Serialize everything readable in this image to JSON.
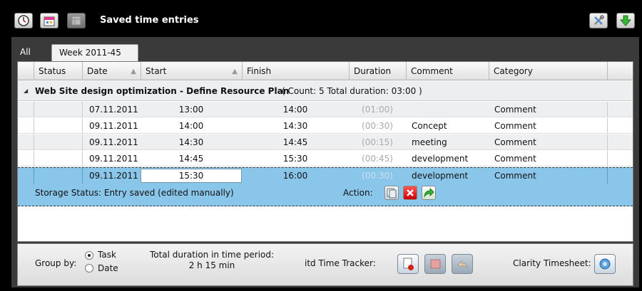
{
  "app": {
    "title": "Saved time entries"
  },
  "toolbar": {
    "icons": [
      "clock-icon",
      "calendar-icon",
      "disabled-grid-icon",
      "settings-tools-icon",
      "download-arrow-icon"
    ]
  },
  "tabs": [
    {
      "label": "All"
    },
    {
      "label": "Week 2011-45"
    }
  ],
  "columns": {
    "status": "Status",
    "date": "Date",
    "start": "Start",
    "finish": "Finish",
    "duration": "Duration",
    "comment": "Comment",
    "category": "Category"
  },
  "group": {
    "title": "Web Site design optimization - Define Resource Plan",
    "summary": "( Count: 5 Total duration: 03:00 )"
  },
  "rows": [
    {
      "date": "07.11.2011",
      "start": "13:00",
      "finish": "14:00",
      "duration": "(01:00)",
      "comment": "",
      "category": "Comment"
    },
    {
      "date": "09.11.2011",
      "start": "14:00",
      "finish": "14:30",
      "duration": "(00:30)",
      "comment": "Concept",
      "category": "Comment"
    },
    {
      "date": "09.11.2011",
      "start": "14:30",
      "finish": "14:45",
      "duration": "(00:15)",
      "comment": "meeting",
      "category": "Comment"
    },
    {
      "date": "09.11.2011",
      "start": "14:45",
      "finish": "15:30",
      "duration": "(00:45)",
      "comment": "development",
      "category": "Comment"
    },
    {
      "date": "09.11.2011",
      "start": "15:30",
      "finish": "16:00",
      "duration": "(00:30)",
      "comment": "development",
      "category": "Comment"
    }
  ],
  "selected_detail": {
    "storage_status": "Storage Status:  Entry saved (edited manually)",
    "action_label": "Action:"
  },
  "bottom": {
    "group_by_label": "Group by:",
    "option_task": "Task",
    "option_date": "Date",
    "selected_option": "Task",
    "total_label": "Total duration in time period:",
    "total_value": "2 h 15 min",
    "itd_label": "itd Time Tracker:",
    "clarity_label": "Clarity Timesheet:"
  },
  "colors": {
    "selection": "#89c6ea",
    "background": "#000000",
    "panel": "#3a3a3a"
  }
}
